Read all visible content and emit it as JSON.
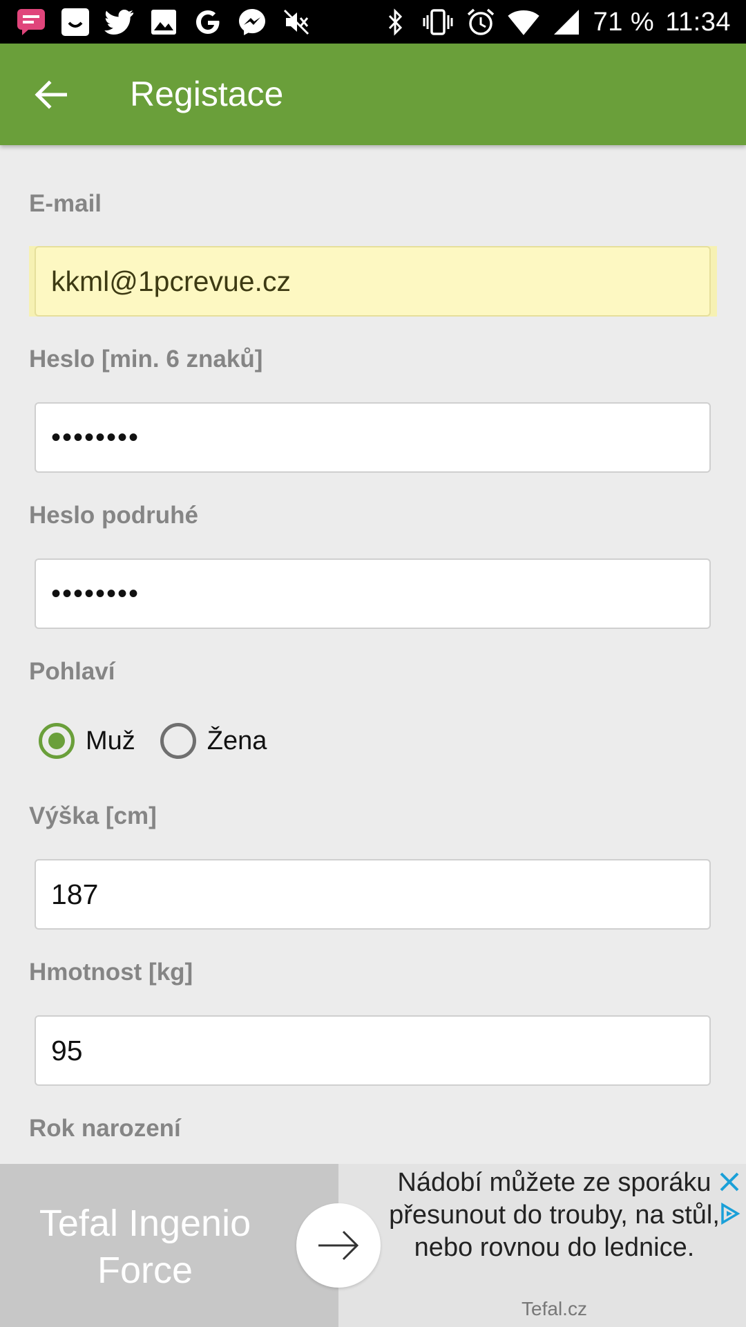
{
  "status_bar": {
    "left_icons": [
      "chat-notification-icon",
      "app-notification-icon",
      "twitter-icon",
      "gallery-icon",
      "google-icon",
      "messenger-icon",
      "mute-icon"
    ],
    "right_icons": [
      "bluetooth-icon",
      "vibrate-icon",
      "alarm-icon",
      "wifi-icon",
      "cell-signal-icon"
    ],
    "battery": "71 %",
    "time": "11:34"
  },
  "appbar": {
    "title": "Registace"
  },
  "form": {
    "email": {
      "label": "E-mail",
      "value": "kkml@1pcrevue.cz"
    },
    "password": {
      "label": "Heslo [min. 6 znaků]",
      "value": "••••••••"
    },
    "password_confirm": {
      "label": "Heslo podruhé",
      "value": "••••••••"
    },
    "gender": {
      "label": "Pohlaví",
      "options": [
        "Muž",
        "Žena"
      ],
      "selected": "Muž"
    },
    "height": {
      "label": "Výška [cm]",
      "value": "187"
    },
    "weight": {
      "label": "Hmotnost [kg]",
      "value": "95"
    },
    "birth_year": {
      "label": "Rok narození"
    }
  },
  "ad": {
    "brand": "Tefal Ingenio Force",
    "text": "Nádobí můžete ze sporáku přesunout do trouby, na stůl, nebo rovnou do lednice.",
    "domain": "Tefal.cz"
  },
  "colors": {
    "accent": "#6a9f3a",
    "autofill": "#fdf8c2",
    "label": "#858585",
    "background": "#ececec"
  }
}
